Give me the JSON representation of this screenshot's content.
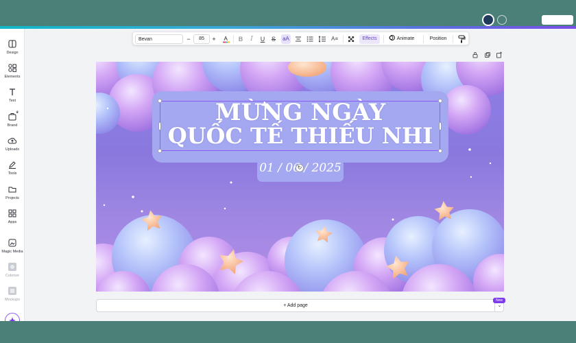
{
  "sidebar": {
    "items": [
      {
        "label": "Design",
        "icon": "layout-icon"
      },
      {
        "label": "Elements",
        "icon": "shapes-icon"
      },
      {
        "label": "Text",
        "icon": "text-icon"
      },
      {
        "label": "Brand",
        "icon": "brand-icon"
      },
      {
        "label": "Uploads",
        "icon": "cloud-upload-icon"
      },
      {
        "label": "Tools",
        "icon": "pen-icon"
      },
      {
        "label": "Projects",
        "icon": "folder-icon"
      },
      {
        "label": "Apps",
        "icon": "apps-grid-icon"
      },
      {
        "label": "Magic Media",
        "icon": "magic-media-icon"
      },
      {
        "label": "Colorize",
        "icon": "colorize-icon"
      },
      {
        "label": "Mockups",
        "icon": "mockups-icon"
      }
    ]
  },
  "toolbar": {
    "font_name": "Bevan",
    "font_size": "85",
    "minus": "−",
    "plus": "+",
    "effects_label": "Effects",
    "animate_label": "Animate",
    "position_label": "Position"
  },
  "canvas": {
    "title_line1": "MỪNG NGÀY",
    "title_line2": "QUỐC TẾ THIẾU NHI",
    "date": "01 / 06 / 2025"
  },
  "footer": {
    "add_page_label": "+ Add page",
    "new_badge": "New"
  },
  "colors": {
    "accent": "#8b5cf6",
    "title_box": "#a3a8f0",
    "background": "#4a8078"
  }
}
